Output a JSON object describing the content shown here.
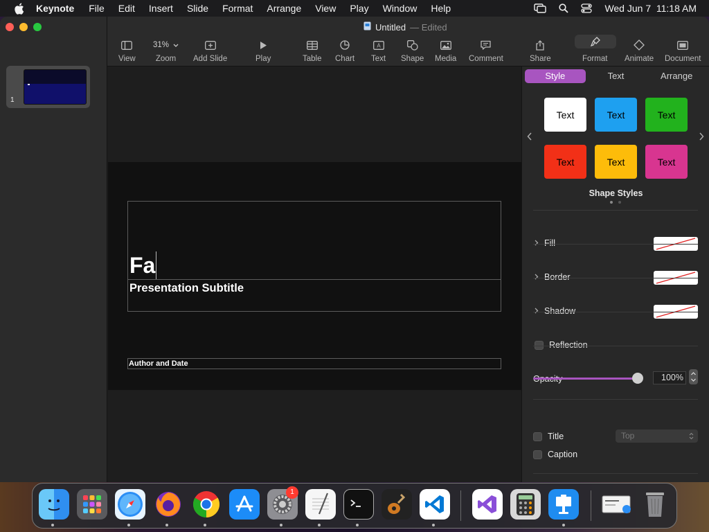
{
  "menubar": {
    "app_name": "Keynote",
    "items": [
      "File",
      "Edit",
      "Insert",
      "Slide",
      "Format",
      "Arrange",
      "View",
      "Play",
      "Window",
      "Help"
    ],
    "datetime": "Wed Jun 7  11:18 AM"
  },
  "window": {
    "doc_title": "Untitled",
    "doc_status": "Edited"
  },
  "sidebar": {
    "slides": [
      {
        "number": "1"
      }
    ]
  },
  "toolbar": {
    "view": "View",
    "zoom_value": "31%",
    "zoom": "Zoom",
    "add_slide": "Add Slide",
    "play": "Play",
    "table": "Table",
    "chart": "Chart",
    "text": "Text",
    "shape": "Shape",
    "media": "Media",
    "comment": "Comment",
    "share": "Share",
    "format": "Format",
    "animate": "Animate",
    "document": "Document"
  },
  "slide": {
    "title": "Fa",
    "subtitle": "Presentation Subtitle",
    "author": "Author and Date"
  },
  "inspector": {
    "tabs": [
      "Style",
      "Text",
      "Arrange"
    ],
    "active_tab": "Style",
    "shape_styles": [
      {
        "label": "Text",
        "bg": "#ffffff",
        "fg": "#000000"
      },
      {
        "label": "Text",
        "bg": "#1ea0f0",
        "fg": "#000000"
      },
      {
        "label": "Text",
        "bg": "#22b21d",
        "fg": "#000000"
      },
      {
        "label": "Text",
        "bg": "#f23017",
        "fg": "#000000"
      },
      {
        "label": "Text",
        "bg": "#fdbc0a",
        "fg": "#000000"
      },
      {
        "label": "Text",
        "bg": "#d83590",
        "fg": "#000000"
      }
    ],
    "shape_styles_label": "Shape Styles",
    "fill": "Fill",
    "border": "Border",
    "shadow": "Shadow",
    "reflection": "Reflection",
    "opacity_label": "Opacity",
    "opacity_value": "100%",
    "opacity_level": 1.0,
    "title_label": "Title",
    "title_position": "Top",
    "caption_label": "Caption",
    "accent_color": "#a855c0"
  },
  "dock": {
    "apps": [
      "finder-icon",
      "launchpad-icon",
      "safari-icon",
      "firefox-icon",
      "chrome-icon",
      "app-store-icon",
      "system-settings-icon",
      "textedit-icon",
      "terminal-icon",
      "garageband-icon",
      "vscode-icon",
      "visual-studio-icon",
      "calculator-icon",
      "keynote-icon",
      "preview-icon",
      "trash-icon"
    ],
    "settings_badge": "1"
  }
}
